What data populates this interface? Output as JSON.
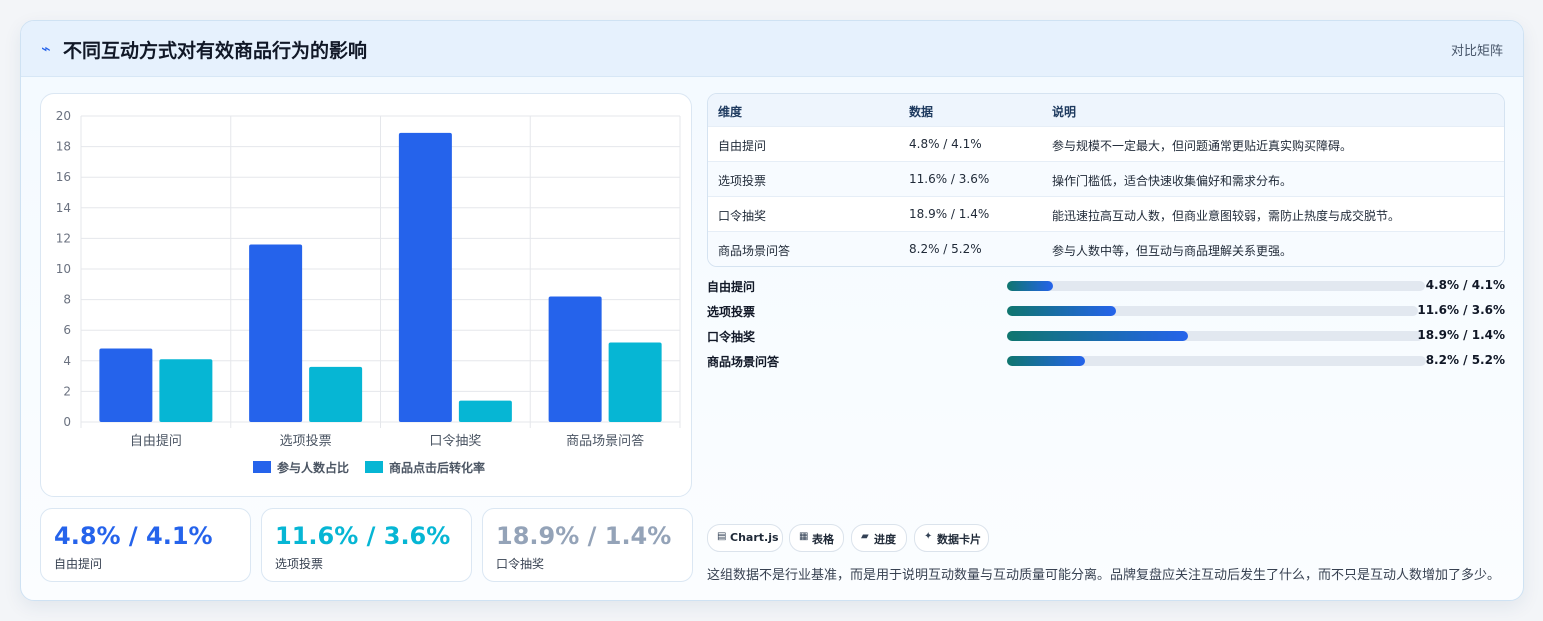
{
  "header": {
    "icon": "chart-spark-icon",
    "icon_glyph": "⌁",
    "title": "不同互动方式对有效商品行为的影响",
    "badge": "对比矩阵"
  },
  "chart_data": {
    "type": "bar",
    "categories": [
      "自由提问",
      "选项投票",
      "口令抽奖",
      "商品场景问答"
    ],
    "series": [
      {
        "name": "参与人数占比",
        "values": [
          4.8,
          11.6,
          18.9,
          8.2
        ],
        "color": "#2563eb"
      },
      {
        "name": "商品点击后转化率",
        "values": [
          4.1,
          3.6,
          1.4,
          5.2
        ],
        "color": "#06b6d4"
      }
    ],
    "ylim": [
      0,
      20
    ],
    "yticks": [
      0,
      2,
      4,
      6,
      8,
      10,
      12,
      14,
      16,
      18,
      20
    ],
    "grid": true,
    "legend": "bottom",
    "title": "",
    "xlabel": "",
    "ylabel": ""
  },
  "stats": [
    {
      "value": "4.8% / 4.1%",
      "label": "自由提问",
      "color": "#2563eb"
    },
    {
      "value": "11.6% / 3.6%",
      "label": "选项投票",
      "color": "#06b6d4"
    },
    {
      "value": "18.9% / 1.4%",
      "label": "口令抽奖",
      "color": "#94a3b8"
    }
  ],
  "table": {
    "headers": [
      "维度",
      "数据",
      "说明"
    ],
    "rows": [
      [
        "自由提问",
        "4.8% / 4.1%",
        "参与规模不一定最大，但问题通常更贴近真实购买障碍。"
      ],
      [
        "选项投票",
        "11.6% / 3.6%",
        "操作门槛低，适合快速收集偏好和需求分布。"
      ],
      [
        "口令抽奖",
        "18.9% / 1.4%",
        "能迅速拉高互动人数，但商业意图较弱，需防止热度与成交脱节。"
      ],
      [
        "商品场景问答",
        "8.2% / 5.2%",
        "参与人数中等，但互动与商品理解关系更强。"
      ]
    ]
  },
  "progress": [
    {
      "label": "自由提问",
      "value": "4.8% / 4.1%",
      "fill": 0.11
    },
    {
      "label": "选项投票",
      "value": "11.6% / 3.6%",
      "fill": 0.265
    },
    {
      "label": "口令抽奖",
      "value": "18.9% / 1.4%",
      "fill": 0.435
    },
    {
      "label": "商品场景问答",
      "value": "8.2% / 5.2%",
      "fill": 0.186
    }
  ],
  "chips": [
    {
      "icon": "chartjs-icon",
      "glyph": "▤",
      "label": "Chart.js"
    },
    {
      "icon": "table-icon",
      "glyph": "▦",
      "label": "表格"
    },
    {
      "icon": "progress-icon",
      "glyph": "▰",
      "label": "进度"
    },
    {
      "icon": "data-card-icon",
      "glyph": "✦",
      "label": "数据卡片"
    }
  ],
  "note": "这组数据不是行业基准，而是用于说明互动数量与互动质量可能分离。品牌复盘应关注互动后发生了什么，而不只是互动人数增加了多少。"
}
